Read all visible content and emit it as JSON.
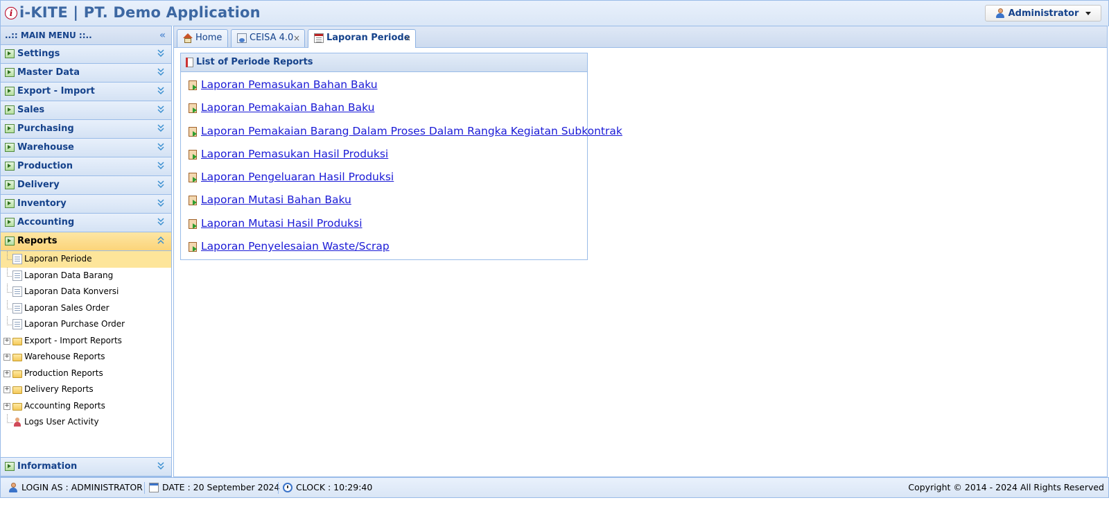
{
  "header": {
    "logo_letter": "i",
    "title": "i-KITE | PT. Demo Application",
    "user_label": "Administrator"
  },
  "sidebar": {
    "title": "..:: MAIN MENU ::..",
    "sections": [
      {
        "label": "Settings"
      },
      {
        "label": "Master Data"
      },
      {
        "label": "Export - Import"
      },
      {
        "label": "Sales"
      },
      {
        "label": "Purchasing"
      },
      {
        "label": "Warehouse"
      },
      {
        "label": "Production"
      },
      {
        "label": "Delivery"
      },
      {
        "label": "Inventory"
      },
      {
        "label": "Accounting"
      },
      {
        "label": "Reports",
        "active": true
      }
    ],
    "reports_items": [
      {
        "label": "Laporan Periode",
        "icon": "report-doc-icon",
        "selected": true
      },
      {
        "label": "Laporan Data Barang",
        "icon": "doc-icon"
      },
      {
        "label": "Laporan Data Konversi",
        "icon": "convert-icon"
      },
      {
        "label": "Laporan Sales Order",
        "icon": "sales-order-icon"
      },
      {
        "label": "Laporan Purchase Order",
        "icon": "purchase-order-icon"
      },
      {
        "label": "Export - Import Reports",
        "icon": "folder-icon",
        "expandable": true
      },
      {
        "label": "Warehouse Reports",
        "icon": "folder-icon",
        "expandable": true
      },
      {
        "label": "Production Reports",
        "icon": "folder-icon",
        "expandable": true
      },
      {
        "label": "Delivery Reports",
        "icon": "folder-icon",
        "expandable": true
      },
      {
        "label": "Accounting Reports",
        "icon": "folder-icon",
        "expandable": true
      },
      {
        "label": "Logs User Activity",
        "icon": "user-log-icon"
      }
    ],
    "bottom_section": {
      "label": "Information"
    }
  },
  "tabs": [
    {
      "label": "Home",
      "icon": "home-icon",
      "closable": false
    },
    {
      "label": "CEISA 4.0",
      "icon": "ceisa-icon",
      "closable": true
    },
    {
      "label": "Laporan Periode",
      "icon": "report-icon",
      "closable": true,
      "active": true
    }
  ],
  "tab_close_glyph": "×",
  "panel": {
    "title": "List of Periode Reports",
    "links": [
      "Laporan Pemasukan Bahan Baku",
      "Laporan Pemakaian Bahan Baku",
      "Laporan Pemakaian Barang Dalam Proses Dalam Rangka Kegiatan Subkontrak",
      "Laporan Pemasukan Hasil Produksi",
      "Laporan Pengeluaran Hasil Produksi",
      "Laporan Mutasi Bahan Baku",
      "Laporan Mutasi Hasil Produksi",
      "Laporan Penyelesaian Waste/Scrap"
    ]
  },
  "footer": {
    "login": "LOGIN AS : ADMINISTRATOR",
    "date": "DATE : 20 September 2024",
    "clock": "CLOCK : 10:29:40",
    "copyright": "Copyright © 2014 - 2024 All Rights Reserved"
  },
  "colors": {
    "header_title": "#3c67a2",
    "border": "#99bbe8",
    "active_section": "#fbd47a",
    "link": "#1a1ad6"
  }
}
